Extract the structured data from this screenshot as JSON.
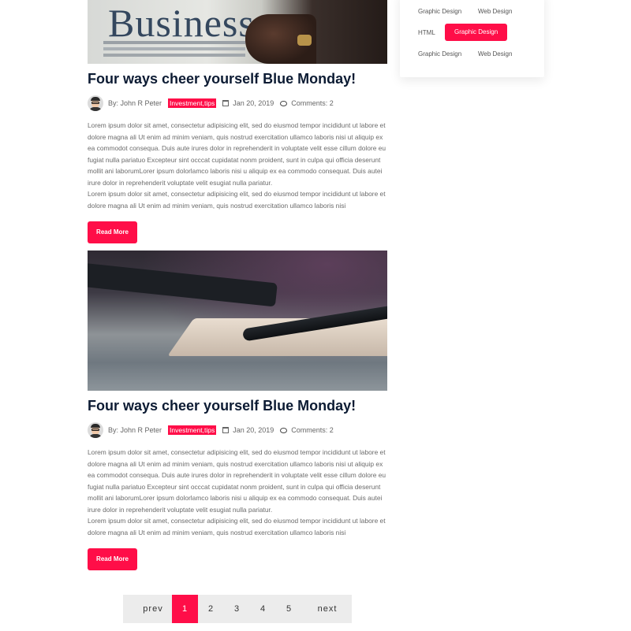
{
  "posts": [
    {
      "title": "Four ways cheer yourself Blue Monday!",
      "image_text": "Business",
      "author": "By: John R Peter",
      "tags": "Investment,tips",
      "date": "Jan 20, 2019",
      "comments": "Comments: 2",
      "body": [
        "Lorem ipsum dolor sit amet, consectetur adipisicing elit, sed do eiusmod tempor incididunt ut labore et dolore magna ali Ut enim ad minim veniam, quis nostrud exercitation ullamco laboris nisi ut aliquip ex ea commodot consequa. Duis aute irures dolor in reprehenderit in voluptate velit esse cillum dolore eu fugiat nulla pariatuo Excepteur sint occcat cupidatat nonm proident, sunt in culpa qui officia deserunt mollit ani laborumLorer ipsum dolorlamco laboris nisi u aliquip ex ea commodo consequat. Duis autei irure dolor in reprehenderit voluptate velit esugiat nulla pariatur.",
        "Lorem ipsum dolor sit amet, consectetur adipisicing elit, sed do eiusmod tempor incididunt ut labore et dolore magna ali Ut enim ad minim veniam, quis nostrud exercitation ullamco laboris nisi"
      ],
      "read_more": "Read More"
    },
    {
      "title": "Four ways cheer yourself Blue Monday!",
      "author": "By: John R Peter",
      "tags": "Investment,tips",
      "date": "Jan 20, 2019",
      "comments": "Comments: 2",
      "body": [
        "Lorem ipsum dolor sit amet, consectetur adipisicing elit, sed do eiusmod tempor incididunt ut labore et dolore magna ali Ut enim ad minim veniam, quis nostrud exercitation ullamco laboris nisi ut aliquip ex ea commodot consequa. Duis aute irures dolor in reprehenderit in voluptate velit esse cillum dolore eu fugiat nulla pariatuo Excepteur sint occcat cupidatat nonm proident, sunt in culpa qui officia deserunt mollit ani laborumLorer ipsum dolorlamco laboris nisi u aliquip ex ea commodo consequat. Duis autei irure dolor in reprehenderit voluptate velit esugiat nulla pariatur.",
        "Lorem ipsum dolor sit amet, consectetur adipisicing elit, sed do eiusmod tempor incididunt ut labore et dolore magna ali Ut enim ad minim veniam, quis nostrud exercitation ullamco laboris nisi"
      ],
      "read_more": "Read More"
    }
  ],
  "sidebar": {
    "tags": [
      "Graphic Design",
      "Web Design",
      "HTML",
      "Graphic Design",
      "Graphic Design",
      "Web Design"
    ],
    "active_tag_index": 3
  },
  "pagination": {
    "prev": "prev",
    "pages": [
      "1",
      "2",
      "3",
      "4",
      "5"
    ],
    "active_page": "1",
    "next": "next"
  },
  "colors": {
    "accent": "#ff0e48",
    "title": "#0c1b33",
    "body_text": "#6b6b6b",
    "pagination_bg": "#ececec"
  },
  "icons": [
    "avatar",
    "calendar-icon",
    "comment-icon"
  ]
}
